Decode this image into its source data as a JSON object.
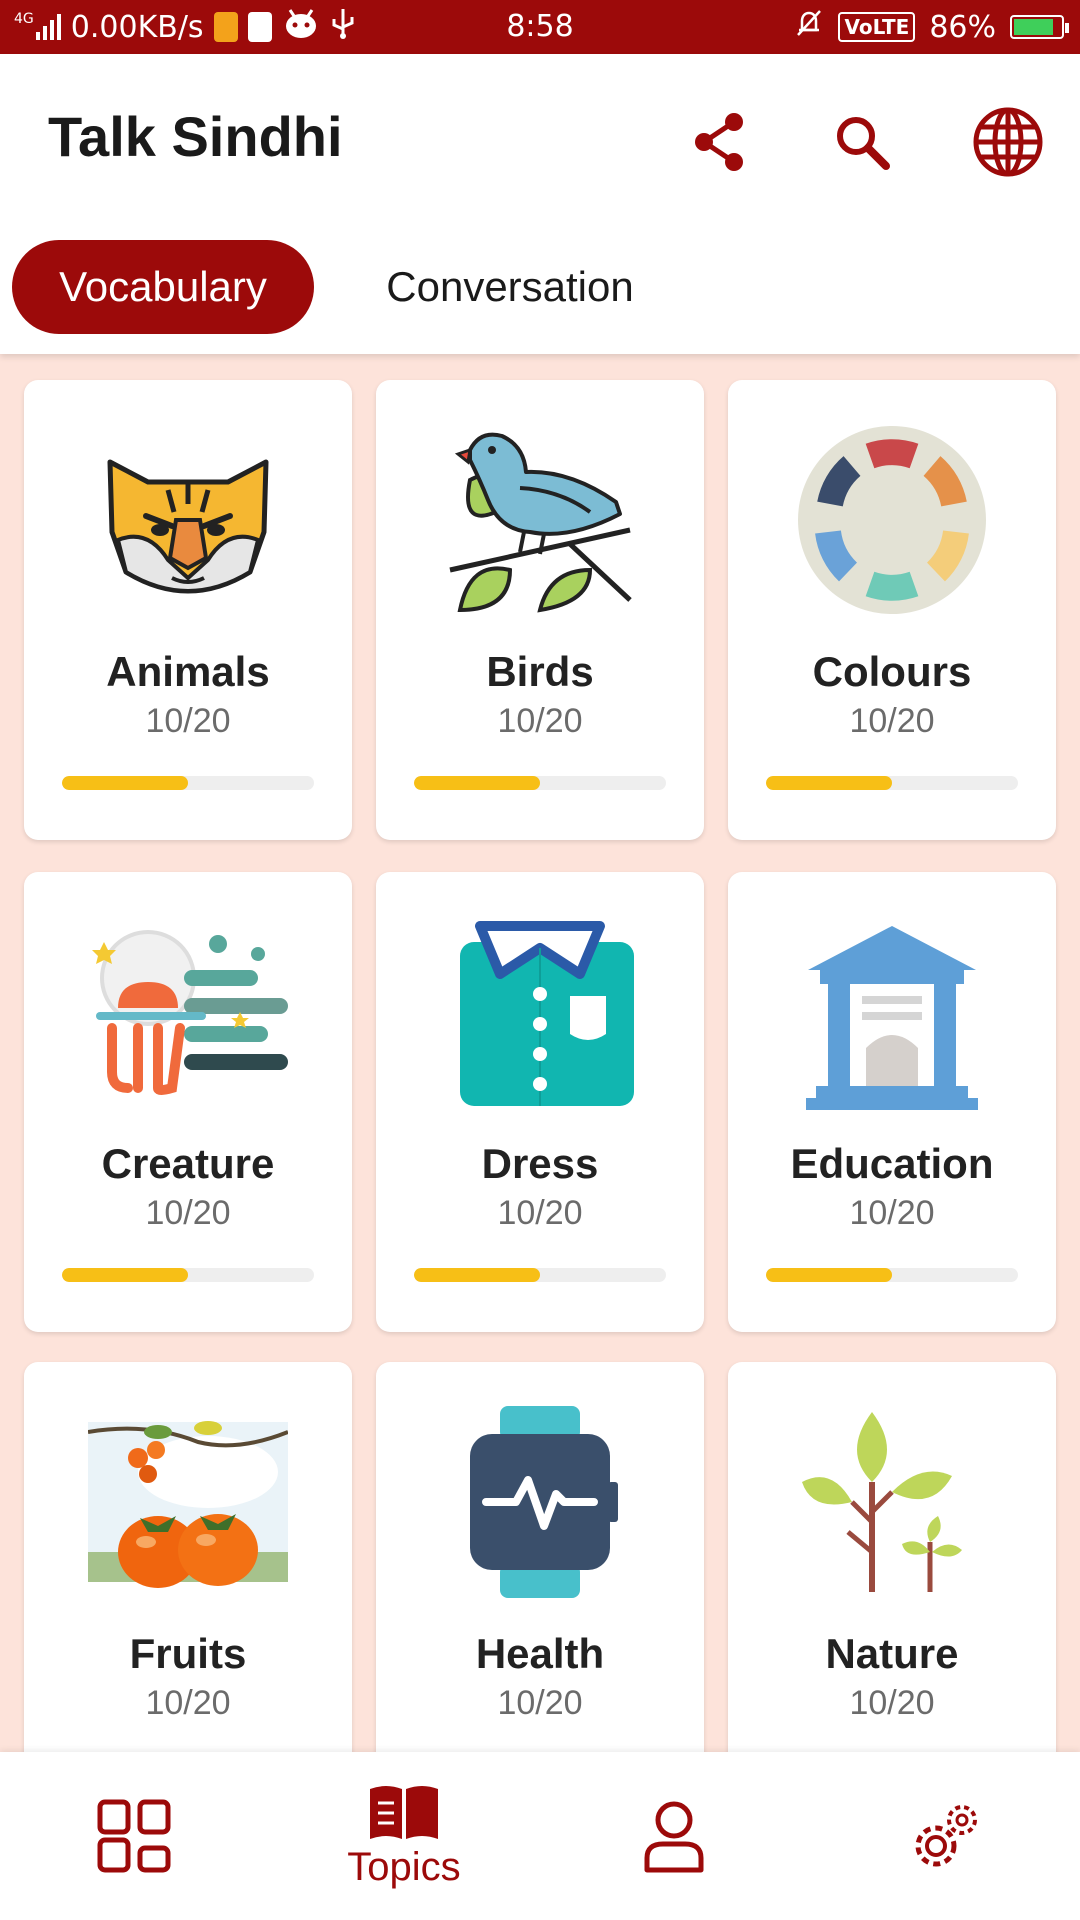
{
  "status_bar": {
    "network": "4G",
    "speed": "0.00KB/s",
    "time": "8:58",
    "volte": "VoLTE",
    "battery": "86%",
    "battery_level": 0.86
  },
  "app_bar": {
    "title": "Talk Sindhi",
    "icons": [
      "share-icon",
      "search-icon",
      "globe-icon"
    ]
  },
  "tabs": [
    {
      "label": "Vocabulary",
      "active": true
    },
    {
      "label": "Conversation",
      "active": false
    }
  ],
  "topics": [
    {
      "name": "Animals",
      "progress": "10/20",
      "fraction": 0.5,
      "icon": "tiger-icon"
    },
    {
      "name": "Birds",
      "progress": "10/20",
      "fraction": 0.5,
      "icon": "bird-icon"
    },
    {
      "name": "Colours",
      "progress": "10/20",
      "fraction": 0.5,
      "icon": "color-wheel-icon"
    },
    {
      "name": "Creature",
      "progress": "10/20",
      "fraction": 0.5,
      "icon": "octopus-icon"
    },
    {
      "name": "Dress",
      "progress": "10/20",
      "fraction": 0.5,
      "icon": "shirt-icon"
    },
    {
      "name": "Education",
      "progress": "10/20",
      "fraction": 0.5,
      "icon": "school-building-icon"
    },
    {
      "name": "Fruits",
      "progress": "10/20",
      "fraction": 0.5,
      "icon": "persimmon-icon"
    },
    {
      "name": "Health",
      "progress": "10/20",
      "fraction": 0.5,
      "icon": "smartwatch-icon"
    },
    {
      "name": "Nature",
      "progress": "10/20",
      "fraction": 0.5,
      "icon": "plant-icon"
    }
  ],
  "bottom_nav": {
    "active_label": "Topics",
    "items": [
      "dashboard-icon",
      "book-icon",
      "profile-icon",
      "settings-icon"
    ]
  },
  "colors": {
    "primary": "#9c0a0a",
    "background": "#fde3da",
    "progress": "#f7bf16"
  }
}
